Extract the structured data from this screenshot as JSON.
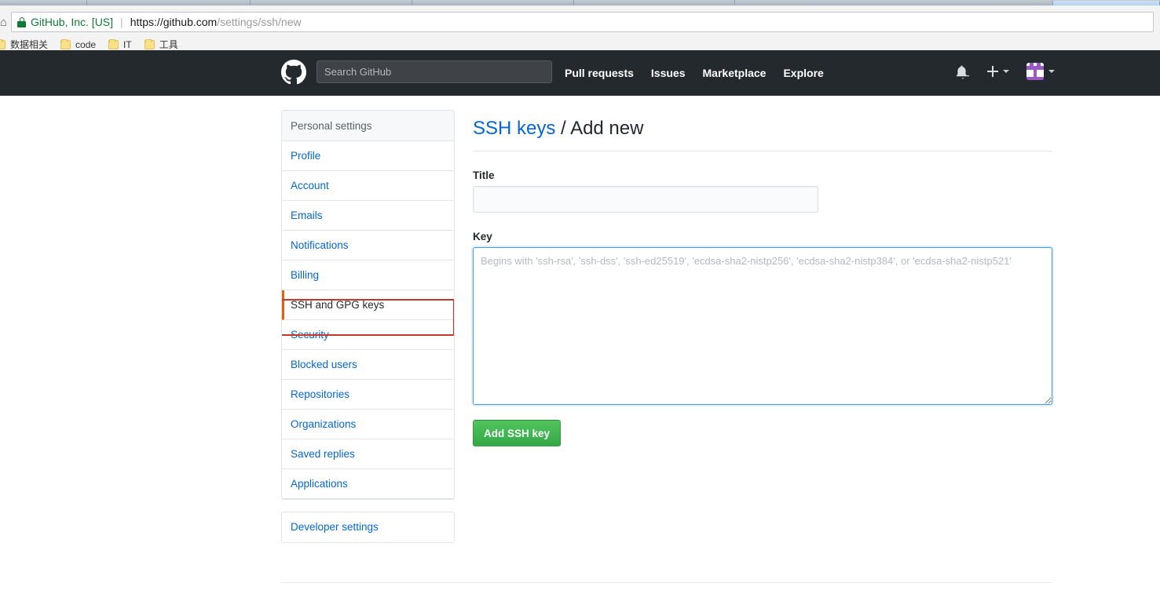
{
  "browser": {
    "site_identity": "GitHub, Inc. [US]",
    "url_host": "https://github.com",
    "url_path": "/settings/ssh/new",
    "url_separator": "|",
    "lock_icon": "padlock-icon",
    "bookmarks": [
      {
        "label": "数据相关",
        "icon": "folder-icon"
      },
      {
        "label": "code",
        "icon": "folder-icon"
      },
      {
        "label": "IT",
        "icon": "folder-icon"
      },
      {
        "label": "工具",
        "icon": "folder-icon"
      }
    ]
  },
  "gh_header": {
    "logo": "github-mark-icon",
    "search_placeholder": "Search GitHub",
    "search_value": "",
    "nav": [
      {
        "label": "Pull requests"
      },
      {
        "label": "Issues"
      },
      {
        "label": "Marketplace"
      },
      {
        "label": "Explore"
      }
    ],
    "notifications_icon": "bell-icon",
    "create_new_icon": "plus-icon",
    "avatar": "user-avatar-identicon",
    "background": "#24292e"
  },
  "sidebar": {
    "header": "Personal settings",
    "items": [
      {
        "label": "Profile",
        "selected": false
      },
      {
        "label": "Account",
        "selected": false
      },
      {
        "label": "Emails",
        "selected": false
      },
      {
        "label": "Notifications",
        "selected": false
      },
      {
        "label": "Billing",
        "selected": false
      },
      {
        "label": "SSH and GPG keys",
        "selected": true
      },
      {
        "label": "Security",
        "selected": false
      },
      {
        "label": "Blocked users",
        "selected": false
      },
      {
        "label": "Repositories",
        "selected": false
      },
      {
        "label": "Organizations",
        "selected": false
      },
      {
        "label": "Saved replies",
        "selected": false
      },
      {
        "label": "Applications",
        "selected": false
      }
    ],
    "secondary": [
      {
        "label": "Developer settings"
      }
    ],
    "selected_accent": "#e36209",
    "highlight_color": "#c0392b"
  },
  "main": {
    "title_link": "SSH keys",
    "title_separator": "/",
    "title_current": "Add new",
    "title_field_label": "Title",
    "title_field_value": "",
    "title_field_placeholder": "",
    "key_field_label": "Key",
    "key_field_value": "",
    "key_field_placeholder": "Begins with 'ssh-rsa', 'ssh-dss', 'ssh-ed25519', 'ecdsa-sha2-nistp256', 'ecdsa-sha2-nistp384', or 'ecdsa-sha2-nistp521'",
    "submit_label": "Add SSH key",
    "submit_color": "#34a847",
    "link_color": "#0366d6"
  }
}
